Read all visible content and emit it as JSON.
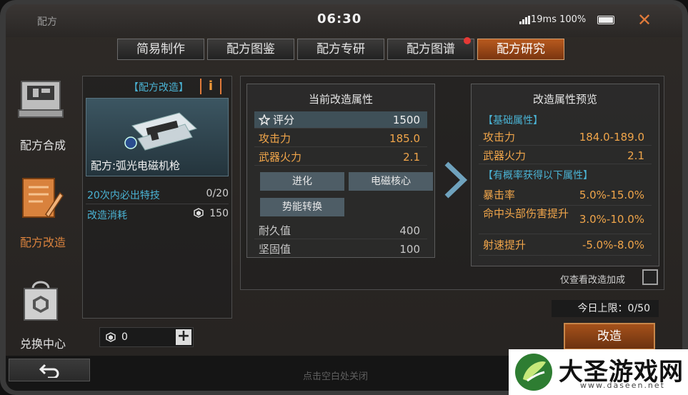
{
  "status_bar": {
    "app_title": "配方",
    "clock": "06:30",
    "network": "19ms 100%"
  },
  "tabs": [
    {
      "label": "简易制作",
      "active": false,
      "badge": false
    },
    {
      "label": "配方图鉴",
      "active": false,
      "badge": false
    },
    {
      "label": "配方专研",
      "active": false,
      "badge": false
    },
    {
      "label": "配方图谱",
      "active": false,
      "badge": true
    },
    {
      "label": "配方研究",
      "active": true,
      "badge": false
    }
  ],
  "sidebar": {
    "items": [
      {
        "label": "配方合成",
        "icon": "crafting-machine-icon",
        "active": false
      },
      {
        "label": "配方改造",
        "icon": "notepad-pencil-icon",
        "active": true
      },
      {
        "label": "兑换中心",
        "icon": "shopping-bag-icon",
        "active": false
      }
    ]
  },
  "left_panel": {
    "header": "【配方改造】",
    "info_label": "i",
    "recipe_name": "配方:弧光电磁机枪",
    "guarantee_label": "20次内必出特技",
    "guarantee_value": "0/20",
    "cost_label": "改造消耗",
    "cost_value": "150",
    "inventory_value": "0",
    "plus_label": "+"
  },
  "current_attrs": {
    "title": "当前改造属性",
    "score_label": "评分",
    "score_value": "1500",
    "rows": [
      {
        "label": "攻击力",
        "value": "185.0"
      },
      {
        "label": "武器火力",
        "value": "2.1"
      }
    ],
    "tags": [
      "进化",
      "电磁核心",
      "势能转换"
    ],
    "stats": [
      {
        "label": "耐久值",
        "value": "400"
      },
      {
        "label": "坚固值",
        "value": "100"
      }
    ]
  },
  "preview_attrs": {
    "title": "改造属性预览",
    "base_section": "【基础属性】",
    "base_rows": [
      {
        "label": "攻击力",
        "value": "184.0-189.0"
      },
      {
        "label": "武器火力",
        "value": "2.1"
      }
    ],
    "chance_section": "【有概率获得以下属性】",
    "chance_rows": [
      {
        "label": "暴击率",
        "value": "5.0%-15.0%"
      },
      {
        "label": "命中头部伤害提升",
        "value": "3.0%-10.0%"
      },
      {
        "label": "射速提升",
        "value": "-5.0%-8.0%"
      }
    ]
  },
  "controls": {
    "only_view_label": "仅查看改造加成",
    "daily_limit": "今日上限：0/50",
    "modify_button": "改造",
    "tap_close": "点击空白处关闭"
  },
  "watermark": {
    "title": "大圣游戏网",
    "url": "www.daseen.net"
  },
  "colors": {
    "accent_orange": "#d9823d",
    "label_blue": "#4ab3d4",
    "attr_gold": "#f0a54a",
    "badge_red": "#e53935"
  }
}
